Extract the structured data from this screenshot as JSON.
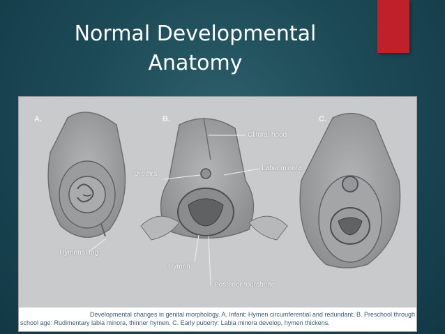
{
  "slide": {
    "title_line1": "Normal Developmental",
    "title_line2": "Anatomy",
    "accent_color": "#c0202a",
    "background_color": "#1d4a57"
  },
  "figure": {
    "panels": [
      "A.",
      "B.",
      "C."
    ],
    "labels": {
      "clitoral_hood": "Clitoral hood",
      "urethra": "Urethra",
      "labia_minora": "Labia minora",
      "hymenal_tag": "Hymenal tag",
      "hymen": "Hymen",
      "posterior_fourchette": "Posterior fourchette"
    },
    "caption_line1": "Developmental changes in genital morphology. A. Infant: Hymen circumferential and redundant. B. Preschool through",
    "caption_line2": "school age: Rudimentary labia minora, thinner hymen. C. Early puberty: Labia minora develop, hymen thickens."
  }
}
